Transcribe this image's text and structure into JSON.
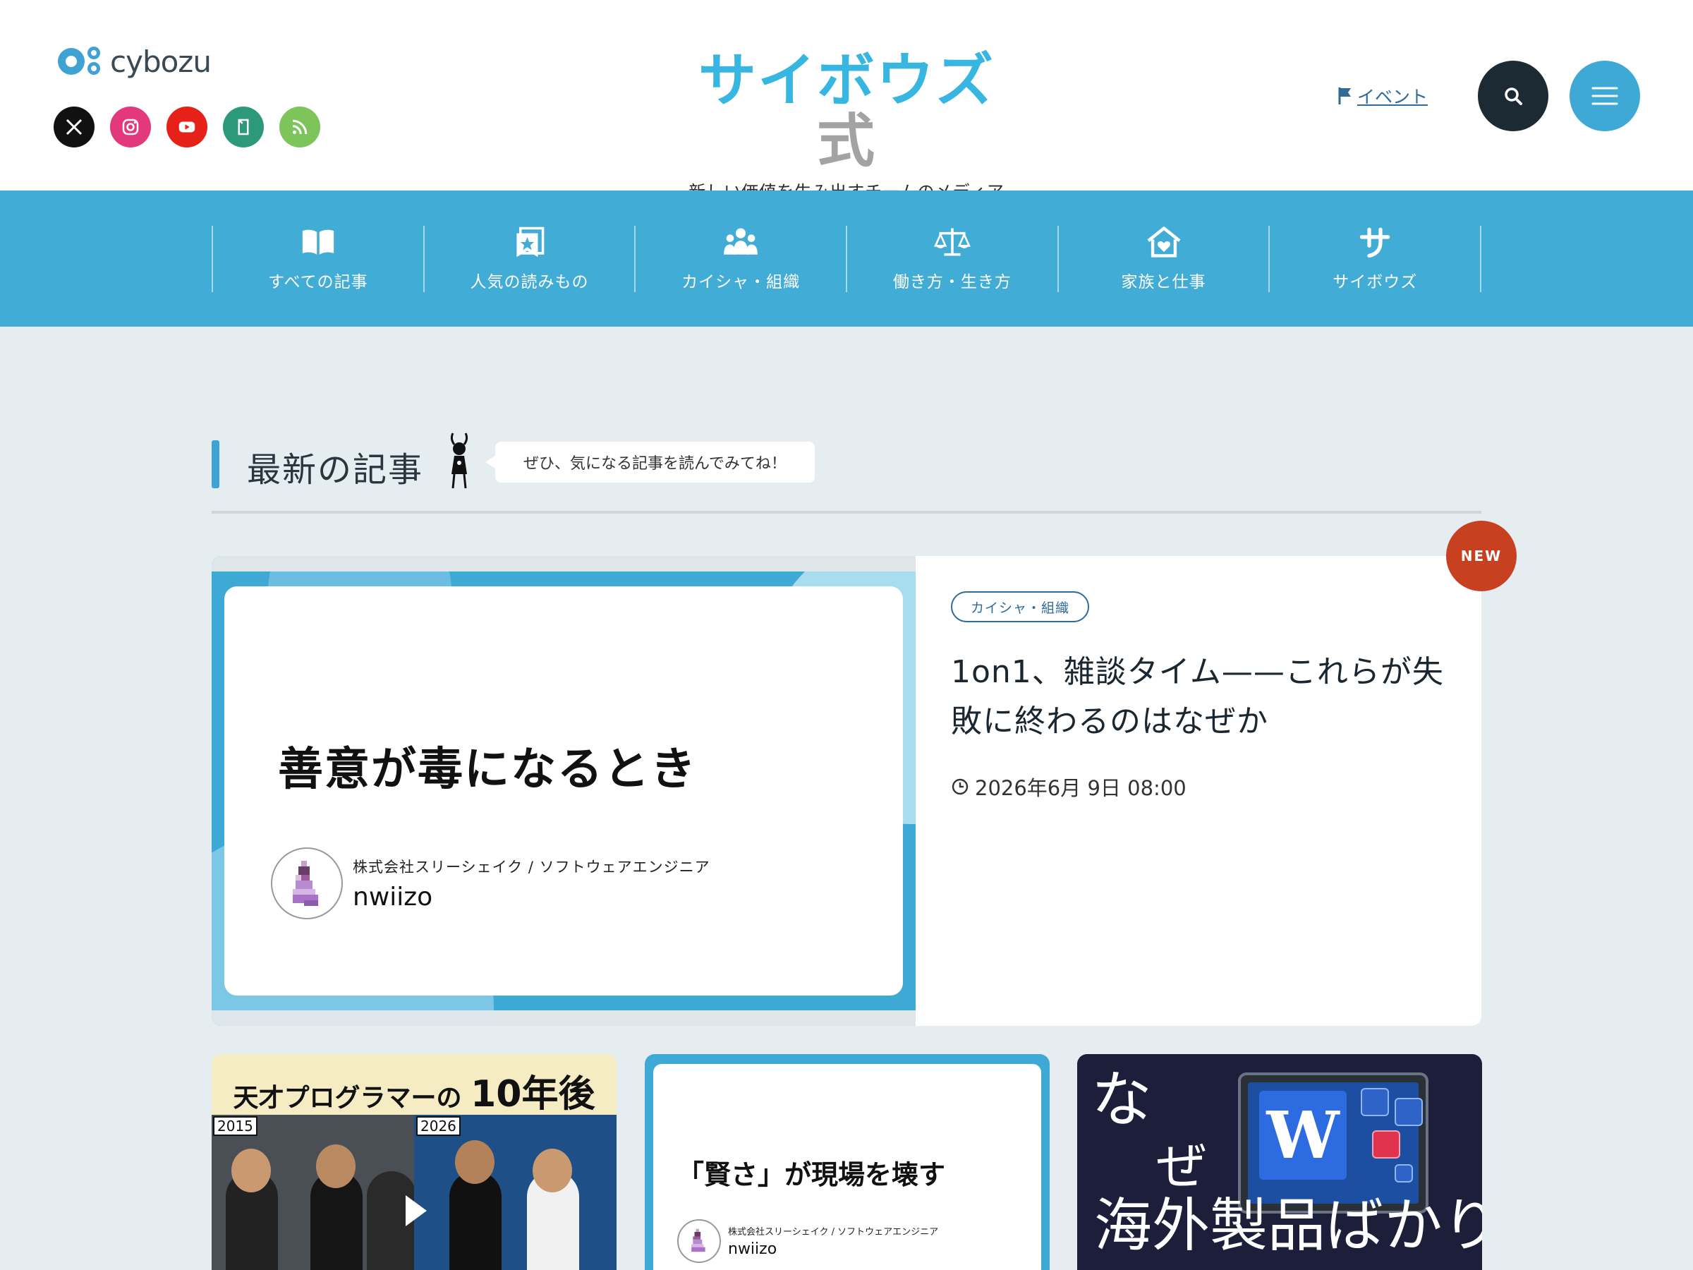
{
  "header": {
    "brand": "cybozu",
    "site_title": "サイボウズ",
    "site_title_suffix": "式",
    "tagline": "新しい価値を生み出すチームのメディア",
    "event_link": "イベント",
    "socials": [
      "x-icon",
      "instagram-icon",
      "youtube-icon",
      "note-icon",
      "rss-icon"
    ]
  },
  "nav": {
    "items": [
      {
        "label": "すべての記事",
        "icon": "book-icon"
      },
      {
        "label": "人気の読みもの",
        "icon": "star-bookmark-icon"
      },
      {
        "label": "カイシャ・組織",
        "icon": "people-icon"
      },
      {
        "label": "働き方・生き方",
        "icon": "scale-icon"
      },
      {
        "label": "家族と仕事",
        "icon": "home-heart-icon"
      },
      {
        "label": "サイボウズ",
        "icon": "sa-icon"
      }
    ]
  },
  "latest": {
    "title": "最新の記事",
    "bubble": "ぜひ、気になる記事を読んでみてね！"
  },
  "featured": {
    "badge": "NEW",
    "image_headline": "善意が毒になるとき",
    "author_org": "株式会社スリーシェイク / ソフトウェアエンジニア",
    "author_name": "nwiizo",
    "tag": "カイシャ・組織",
    "title": "1on1、雑談タイム——これらが失敗に終わるのはなぜか",
    "date": "2026年6月 9日 08:00"
  },
  "cards": {
    "card1": {
      "title_prefix": "天才プログラマーの",
      "title_big": "10年後",
      "year_left": "2015",
      "year_right": "2026"
    },
    "card2": {
      "title": "「賢さ」が現場を壊す",
      "author_org": "株式会社スリーシェイク / ソフトウェアエンジニア",
      "author_name": "nwiizo"
    },
    "card3": {
      "line1": "な",
      "line2": "ぜ",
      "line3": "海外製品ばかりに?",
      "app_letter": "W"
    }
  },
  "colors": {
    "accent": "#41acd6",
    "new_badge": "#c7401f",
    "dark": "#1c2b33"
  }
}
